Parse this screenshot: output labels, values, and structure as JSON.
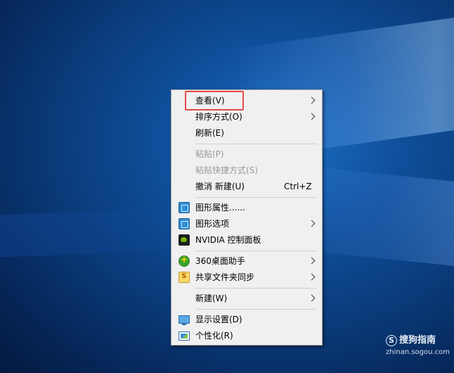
{
  "context_menu": {
    "items": [
      {
        "label": "查看(V)",
        "has_submenu": true,
        "disabled": false
      },
      {
        "label": "排序方式(O)",
        "has_submenu": true,
        "disabled": false
      },
      {
        "label": "刷新(E)",
        "has_submenu": false,
        "disabled": false
      },
      {
        "label": "粘贴(P)",
        "has_submenu": false,
        "disabled": true
      },
      {
        "label": "粘贴快捷方式(S)",
        "has_submenu": false,
        "disabled": true
      },
      {
        "label": "撤消 新建(U)",
        "shortcut": "Ctrl+Z",
        "has_submenu": false,
        "disabled": false
      },
      {
        "label": "图形属性......",
        "icon": "intel-graphics-icon",
        "has_submenu": false,
        "disabled": false
      },
      {
        "label": "图形选项",
        "icon": "intel-graphics-icon",
        "has_submenu": true,
        "disabled": false
      },
      {
        "label": "NVIDIA 控制面板",
        "icon": "nvidia-icon",
        "has_submenu": false,
        "disabled": false
      },
      {
        "label": "360桌面助手",
        "icon": "360-icon",
        "has_submenu": true,
        "disabled": false
      },
      {
        "label": "共享文件夹同步",
        "icon": "share-sync-icon",
        "has_submenu": true,
        "disabled": false
      },
      {
        "label": "新建(W)",
        "has_submenu": true,
        "disabled": false
      },
      {
        "label": "显示设置(D)",
        "icon": "display-icon",
        "has_submenu": false,
        "disabled": false
      },
      {
        "label": "个性化(R)",
        "icon": "personalize-icon",
        "has_submenu": false,
        "disabled": false
      }
    ],
    "highlighted_item": "查看(V)",
    "highlight_color": "#e24a4a"
  },
  "watermark": {
    "logo_glyph": "S",
    "title": "搜狗指南",
    "url": "zhinan.sogou.com"
  },
  "colors": {
    "desktop_background": "#0a3a78",
    "menu_background": "#f0f0f0",
    "disabled_text": "#9a9a9a"
  }
}
